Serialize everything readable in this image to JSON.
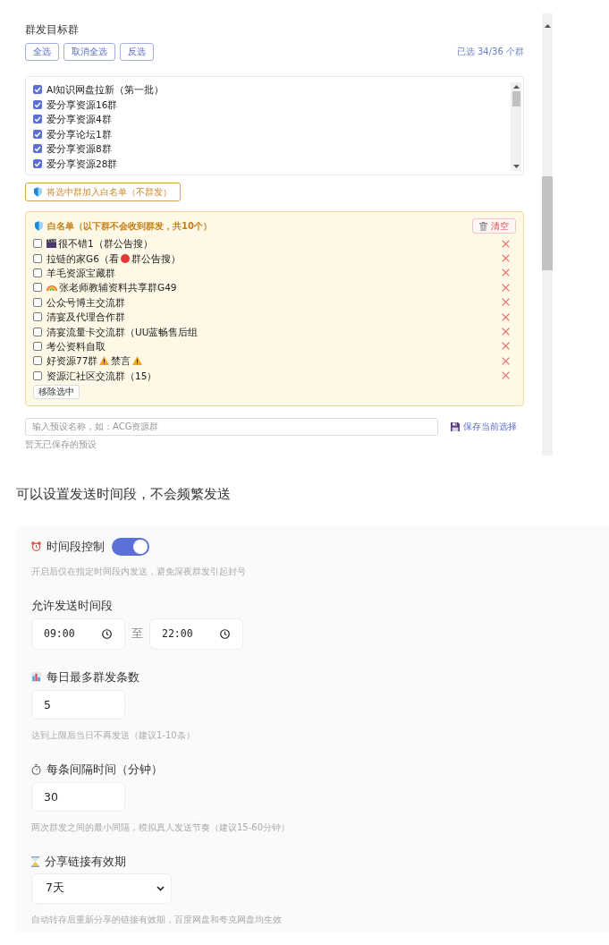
{
  "target_groups_panel": {
    "title": "群发目标群",
    "buttons": [
      {
        "label": "全选"
      },
      {
        "label": "取消全选"
      },
      {
        "label": "反选"
      }
    ],
    "selected_count": "已选 34/36 个群",
    "group_list": [
      {
        "label": "AI知识网盘拉新（第一批）",
        "checked": true
      },
      {
        "label": "爱分享资源16群",
        "checked": true
      },
      {
        "label": "爱分享资源4群",
        "checked": true
      },
      {
        "label": "爱分享论坛1群",
        "checked": true
      },
      {
        "label": "爱分享资源8群",
        "checked": true
      },
      {
        "label": "爱分享资源28群",
        "checked": true
      }
    ],
    "add_to_whitelist_button": "将选中群加入白名单（不群发）",
    "whitelist": {
      "title": "白名单（以下群不会收到群发，共10个）",
      "clear_button": "清空",
      "items": [
        {
          "checked": false,
          "parts": [
            {
              "kind": "clapper"
            },
            {
              "kind": "text",
              "text": "很不错1（群公告搜）"
            }
          ]
        },
        {
          "checked": false,
          "parts": [
            {
              "kind": "text",
              "text": "拉链的家G6（看"
            },
            {
              "kind": "dot"
            },
            {
              "kind": "text",
              "text": "群公告搜）"
            }
          ]
        },
        {
          "checked": false,
          "parts": [
            {
              "kind": "text",
              "text": "羊毛资源宝藏群"
            }
          ]
        },
        {
          "checked": false,
          "parts": [
            {
              "kind": "rainbow"
            },
            {
              "kind": "text",
              "text": "张老师教辅资料共享群G49"
            }
          ]
        },
        {
          "checked": false,
          "parts": [
            {
              "kind": "text",
              "text": "公众号博主交流群"
            }
          ]
        },
        {
          "checked": false,
          "parts": [
            {
              "kind": "text",
              "text": "清宴及代理合作群"
            }
          ]
        },
        {
          "checked": false,
          "parts": [
            {
              "kind": "text",
              "text": "清宴流量卡交流群（UU蓝畅售后组"
            }
          ]
        },
        {
          "checked": false,
          "parts": [
            {
              "kind": "text",
              "text": "考公资料自取"
            }
          ]
        },
        {
          "checked": false,
          "parts": [
            {
              "kind": "text",
              "text": "好资源77群"
            },
            {
              "kind": "warning"
            },
            {
              "kind": "text",
              "text": "禁言"
            },
            {
              "kind": "warning"
            }
          ]
        },
        {
          "checked": false,
          "parts": [
            {
              "kind": "text",
              "text": "资源汇社区交流群（15）"
            }
          ]
        }
      ],
      "remove_selected_button": "移除选中"
    },
    "preset_input": {
      "placeholder": "输入预设名称，如：ACG资源群"
    },
    "save_button": "保存当前选择",
    "preset_empty": "暂无已保存的预设"
  },
  "caption": "可以设置发送时间段，不会频繁发送",
  "send_schedule_panel": {
    "time_control": {
      "label": "时间段控制",
      "on": true,
      "hint": "开启后仅在指定时间段内发送，避免深夜群发引起封号"
    },
    "time_range": {
      "label": "允许发送时间段",
      "start": "09:00",
      "separator": "至",
      "end": "22:00"
    },
    "daily_max": {
      "label": "每日最多群发条数",
      "value": "5",
      "hint": "达到上限后当日不再发送（建议1-10条）"
    },
    "interval": {
      "label": "每条间隔时间（分钟）",
      "value": "30",
      "hint": "两次群发之间的最小间隔，模拟真人发送节奏（建议15-60分钟）"
    },
    "link_validity": {
      "label": "分享链接有效期",
      "value": "7天",
      "hint": "自动转存后重新分享的链接有效期，百度网盘和夸克网盘均生效"
    }
  }
}
